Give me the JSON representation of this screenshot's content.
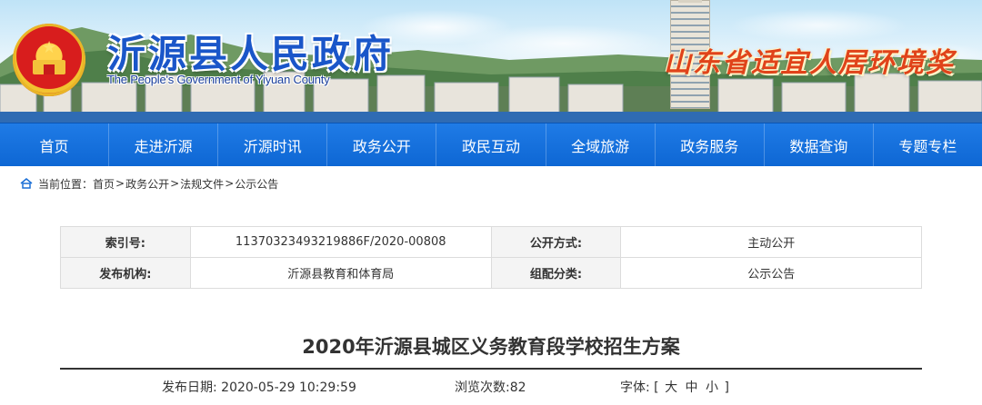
{
  "header": {
    "title": "沂源县人民政府",
    "subtitle": "The People's Government of Yiyuan County",
    "award": "山东省适宜人居环境奖"
  },
  "nav": [
    "首页",
    "走进沂源",
    "沂源时讯",
    "政务公开",
    "政民互动",
    "全域旅游",
    "政务服务",
    "数据查询",
    "专题专栏"
  ],
  "breadcrumb": {
    "prefix": "当前位置：",
    "items": [
      "首页",
      "政务公开",
      "法规文件",
      "公示公告"
    ],
    "sep": ">"
  },
  "info": {
    "index_label": "索引号:",
    "index_value": "11370323493219886F/2020-00808",
    "method_label": "公开方式:",
    "method_value": "主动公开",
    "publisher_label": "发布机构:",
    "publisher_value": "沂源县教育和体育局",
    "category_label": "组配分类:",
    "category_value": "公示公告"
  },
  "article": {
    "title": "2020年沂源县城区义务教育段学校招生方案",
    "date_label": "发布日期:",
    "date_value": "2020-05-29 10:29:59",
    "views_label": "浏览次数:",
    "views_value": "82",
    "font_label": "字体:",
    "font_open": "[",
    "font_large": "大",
    "font_medium": "中",
    "font_small": "小",
    "font_close": "]"
  },
  "colors": {
    "nav_blue": "#0e67d4",
    "title_blue": "#1a56c9",
    "award_red": "#e0431a"
  }
}
